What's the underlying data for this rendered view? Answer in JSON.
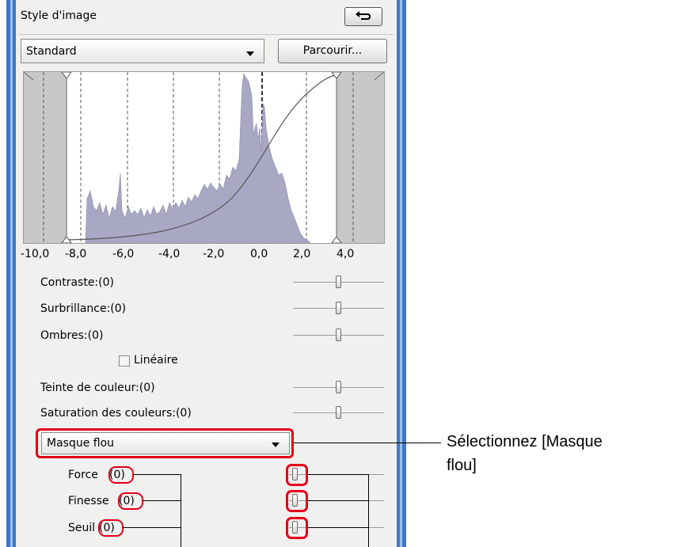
{
  "panel": {
    "title": "Style d'image",
    "back_icon": "undo-arrow-icon",
    "style_select": {
      "value": "Standard"
    },
    "browse_button": "Parcourir...",
    "histogram": {
      "axis_ticks": [
        "-10,0",
        "-8,0",
        "-6,0",
        "-4,0",
        "-2,0",
        "0,0",
        "2,0",
        "4,0"
      ],
      "fill_color": "#a8a8c4",
      "clip_color": "#c8c8c8"
    },
    "adjustments": [
      {
        "label": "Contraste:(0)",
        "value": 0
      },
      {
        "label": "Surbrillance:(0)",
        "value": 0
      },
      {
        "label": "Ombres:(0)",
        "value": 0
      },
      {
        "label": "Teinte de couleur:(0)",
        "value": 0
      },
      {
        "label": "Saturation des couleurs:(0)",
        "value": 0
      }
    ],
    "linear_checkbox": {
      "label": "Linéaire",
      "checked": false
    },
    "sharpness_select": {
      "value": "Masque flou"
    },
    "sharpness": [
      {
        "name": "Force",
        "value": "(0)"
      },
      {
        "name": "Finesse",
        "value": "(0)"
      },
      {
        "name": "Seuil",
        "value": "(0)"
      }
    ]
  },
  "callout": {
    "text": "Sélectionnez [Masque flou]",
    "line1": "Sélectionnez [Masque",
    "line2": "flou]"
  },
  "colors": {
    "highlight": "#e4001a",
    "frame": "#3f78c9"
  }
}
